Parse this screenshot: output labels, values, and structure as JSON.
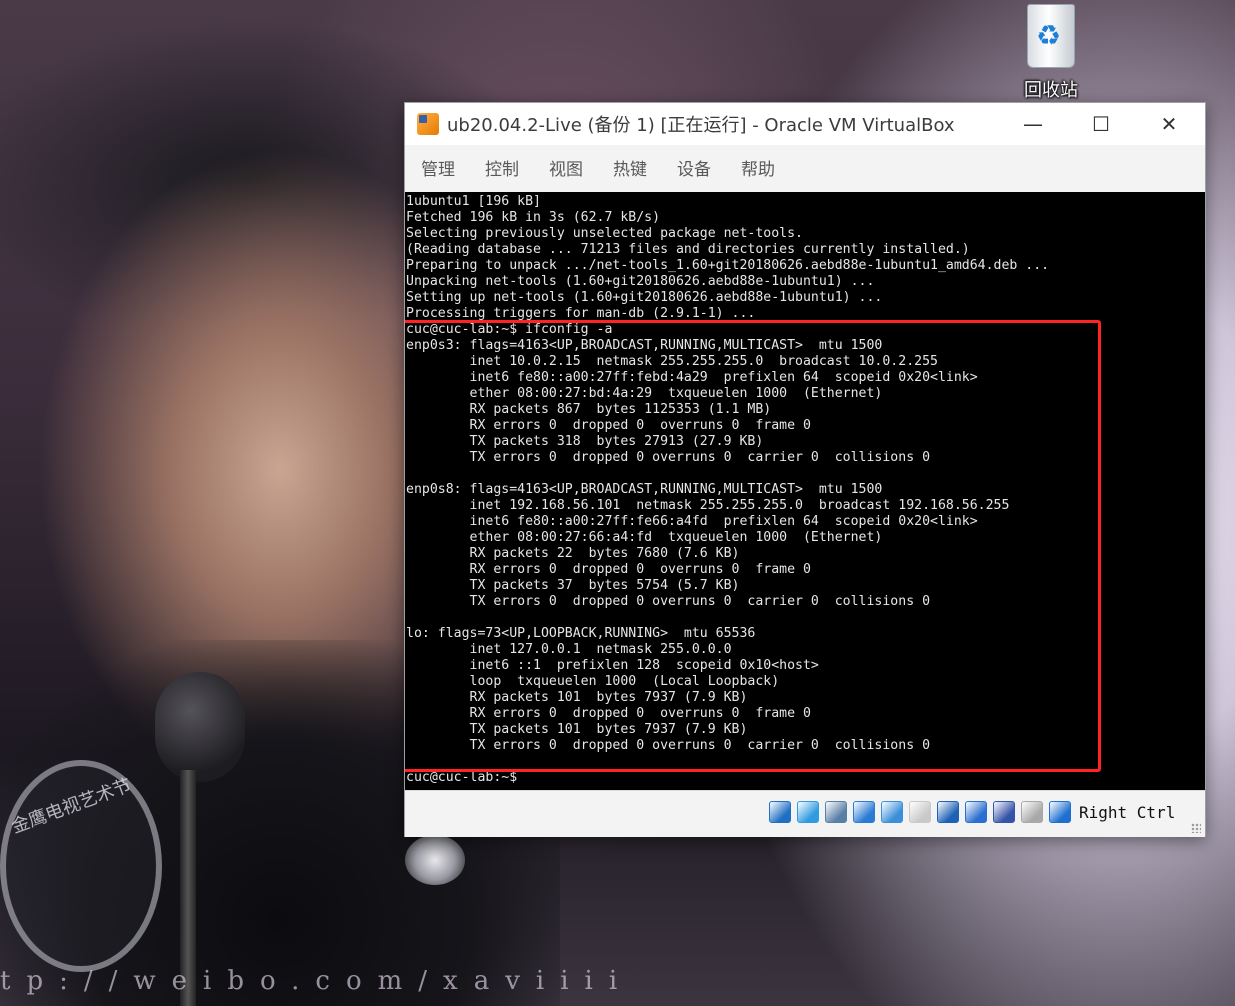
{
  "desktop": {
    "recycle_bin_label": "回收站",
    "watermark": "tp://weibo.com/xaviiii",
    "trophy_text": "金鹰电视艺术节"
  },
  "window": {
    "title": "ub20.04.2-Live (备份 1) [正在运行] - Oracle VM VirtualBox",
    "controls": {
      "minimize": "—",
      "maximize": "☐",
      "close": "✕"
    }
  },
  "menu": {
    "items": [
      "管理",
      "控制",
      "视图",
      "热键",
      "设备",
      "帮助"
    ]
  },
  "terminal": {
    "lines": [
      "1ubuntu1 [196 kB]",
      "Fetched 196 kB in 3s (62.7 kB/s)",
      "Selecting previously unselected package net-tools.",
      "(Reading database ... 71213 files and directories currently installed.)",
      "Preparing to unpack .../net-tools_1.60+git20180626.aebd88e-1ubuntu1_amd64.deb ...",
      "Unpacking net-tools (1.60+git20180626.aebd88e-1ubuntu1) ...",
      "Setting up net-tools (1.60+git20180626.aebd88e-1ubuntu1) ...",
      "Processing triggers for man-db (2.9.1-1) ...",
      "cuc@cuc-lab:~$ ifconfig -a",
      "enp0s3: flags=4163<UP,BROADCAST,RUNNING,MULTICAST>  mtu 1500",
      "        inet 10.0.2.15  netmask 255.255.255.0  broadcast 10.0.2.255",
      "        inet6 fe80::a00:27ff:febd:4a29  prefixlen 64  scopeid 0x20<link>",
      "        ether 08:00:27:bd:4a:29  txqueuelen 1000  (Ethernet)",
      "        RX packets 867  bytes 1125353 (1.1 MB)",
      "        RX errors 0  dropped 0  overruns 0  frame 0",
      "        TX packets 318  bytes 27913 (27.9 KB)",
      "        TX errors 0  dropped 0 overruns 0  carrier 0  collisions 0",
      "",
      "enp0s8: flags=4163<UP,BROADCAST,RUNNING,MULTICAST>  mtu 1500",
      "        inet 192.168.56.101  netmask 255.255.255.0  broadcast 192.168.56.255",
      "        inet6 fe80::a00:27ff:fe66:a4fd  prefixlen 64  scopeid 0x20<link>",
      "        ether 08:00:27:66:a4:fd  txqueuelen 1000  (Ethernet)",
      "        RX packets 22  bytes 7680 (7.6 KB)",
      "        RX errors 0  dropped 0  overruns 0  frame 0",
      "        TX packets 37  bytes 5754 (5.7 KB)",
      "        TX errors 0  dropped 0 overruns 0  carrier 0  collisions 0",
      "",
      "lo: flags=73<UP,LOOPBACK,RUNNING>  mtu 65536",
      "        inet 127.0.0.1  netmask 255.0.0.0",
      "        inet6 ::1  prefixlen 128  scopeid 0x10<host>",
      "        loop  txqueuelen 1000  (Local Loopback)",
      "        RX packets 101  bytes 7937 (7.9 KB)",
      "        RX errors 0  dropped 0  overruns 0  frame 0",
      "        TX packets 101  bytes 7937 (7.9 KB)",
      "        TX errors 0  dropped 0 overruns 0  carrier 0  collisions 0",
      "",
      "cuc@cuc-lab:~$"
    ]
  },
  "statusbar": {
    "host_key": "Right Ctrl",
    "icons": [
      {
        "name": "hard-disk-icon",
        "color": "#1f6fc4"
      },
      {
        "name": "optical-drive-icon",
        "color": "#2f9be0"
      },
      {
        "name": "audio-icon",
        "color": "#5a7fa6"
      },
      {
        "name": "network-icon",
        "color": "#2a7bd4"
      },
      {
        "name": "usb-icon",
        "color": "#3a8fd8"
      },
      {
        "name": "shared-folders-icon",
        "color": "#c9c9c9"
      },
      {
        "name": "display-icon",
        "color": "#1e62b5"
      },
      {
        "name": "video-capture-icon",
        "color": "#2a6fcf"
      },
      {
        "name": "virtualization-icon",
        "color": "#3553a8"
      },
      {
        "name": "mouse-integration-icon",
        "color": "#a8a8a8"
      },
      {
        "name": "keyboard-capture-icon",
        "color": "#1f6fd0"
      }
    ]
  }
}
